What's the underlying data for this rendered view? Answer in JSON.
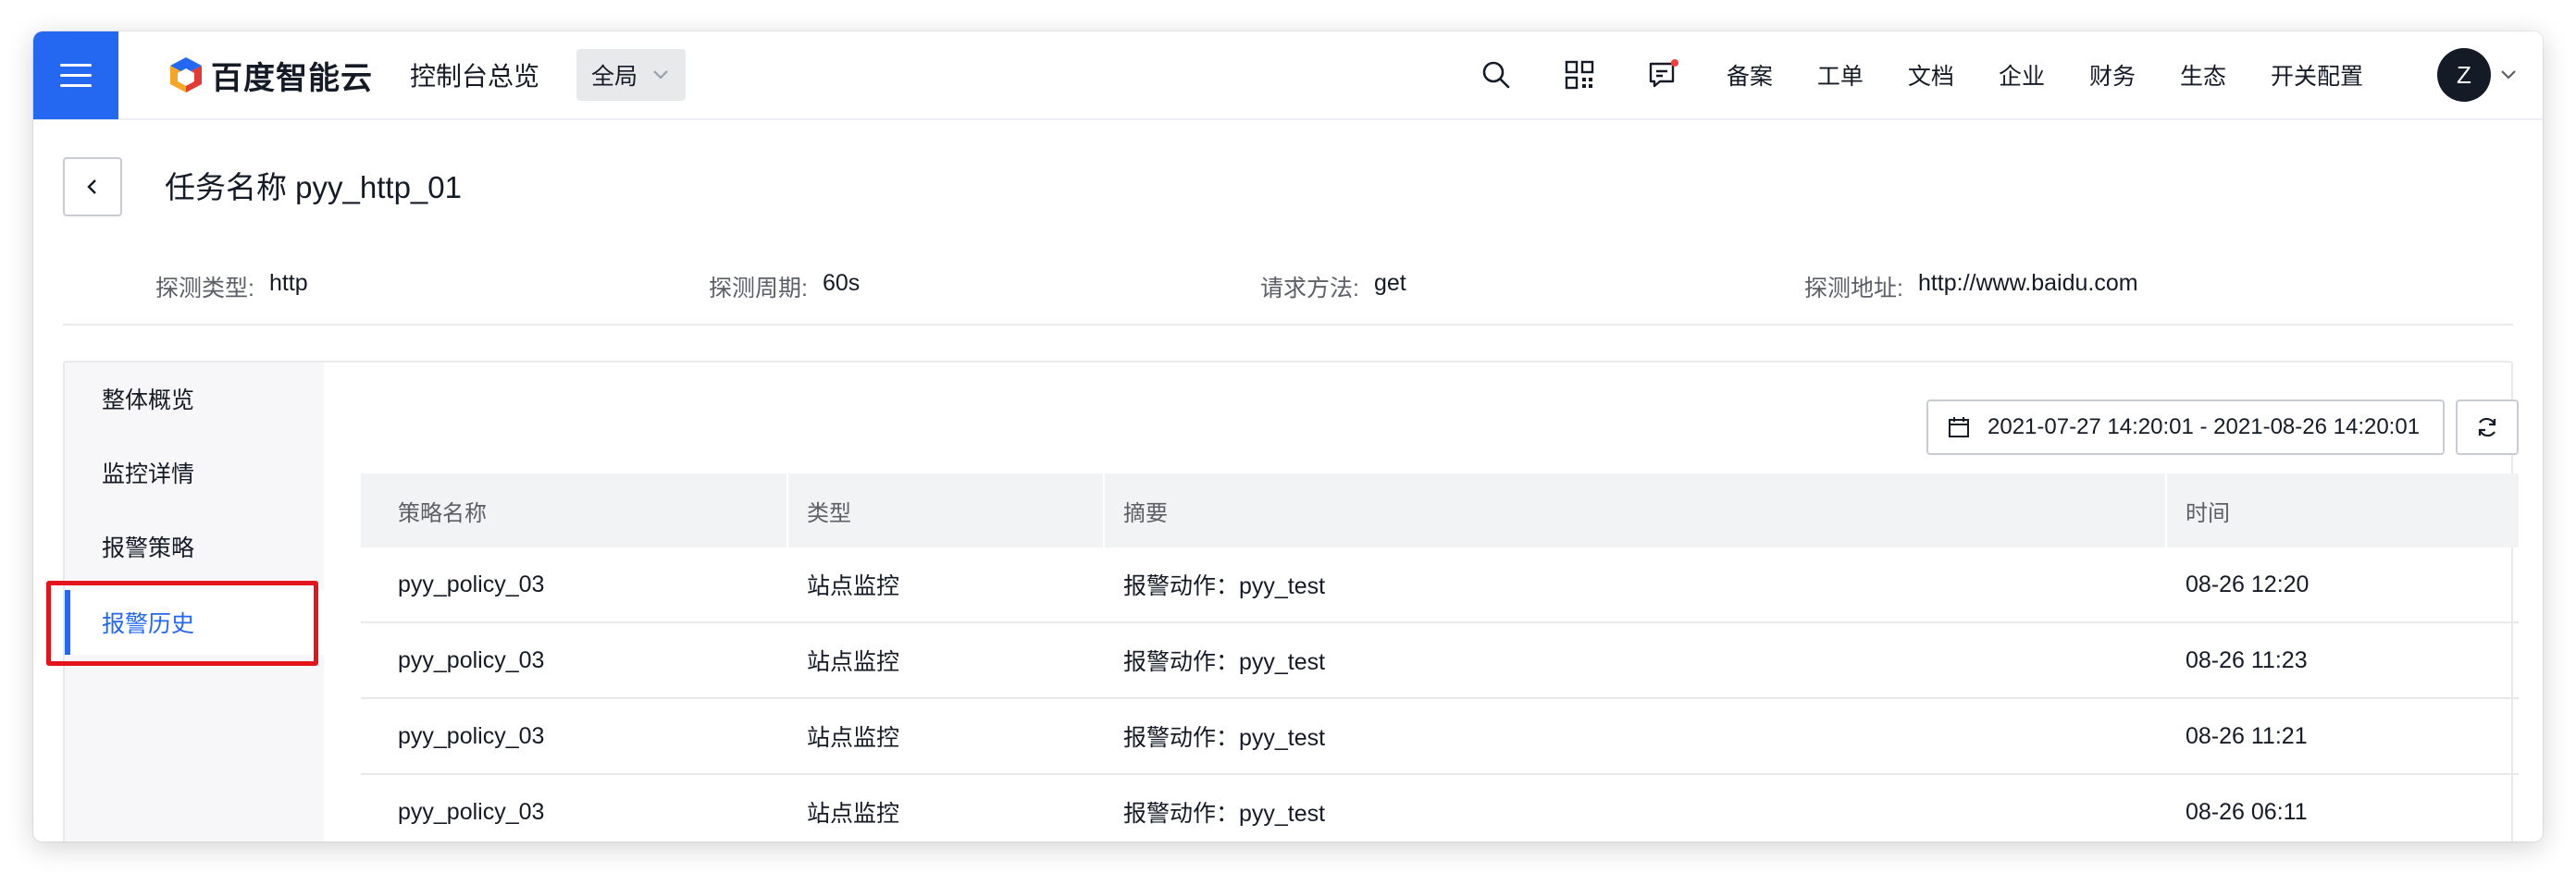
{
  "topbar": {
    "logo_text": "百度智能云",
    "console_title": "控制台总览",
    "region": "全局",
    "nav_links": [
      "备案",
      "工单",
      "文档",
      "企业",
      "财务",
      "生态",
      "开关配置"
    ],
    "avatar_letter": "Z"
  },
  "header": {
    "title": "任务名称 pyy_http_01",
    "meta": [
      {
        "label": "探测类型:",
        "value": "http"
      },
      {
        "label": "探测周期:",
        "value": "60s"
      },
      {
        "label": "请求方法:",
        "value": "get"
      },
      {
        "label": "探测地址:",
        "value": "http://www.baidu.com"
      }
    ]
  },
  "sidebar": {
    "items": [
      {
        "label": "整体概览"
      },
      {
        "label": "监控详情"
      },
      {
        "label": "报警策略"
      },
      {
        "label": "报警历史"
      }
    ]
  },
  "toolbar": {
    "date_range": "2021-07-27 14:20:01 - 2021-08-26 14:20:01"
  },
  "table": {
    "columns": [
      "策略名称",
      "类型",
      "摘要",
      "时间"
    ],
    "rows": [
      [
        "pyy_policy_03",
        "站点监控",
        "报警动作：pyy_test",
        "08-26 12:20"
      ],
      [
        "pyy_policy_03",
        "站点监控",
        "报警动作：pyy_test",
        "08-26 11:23"
      ],
      [
        "pyy_policy_03",
        "站点监控",
        "报警动作：pyy_test",
        "08-26 11:21"
      ],
      [
        "pyy_policy_03",
        "站点监控",
        "报警动作：pyy_test",
        "08-26 06:11"
      ]
    ]
  },
  "colors": {
    "accent": "#2468f2",
    "highlight": "#e3141b",
    "notification_dot": "#f33e3e"
  }
}
